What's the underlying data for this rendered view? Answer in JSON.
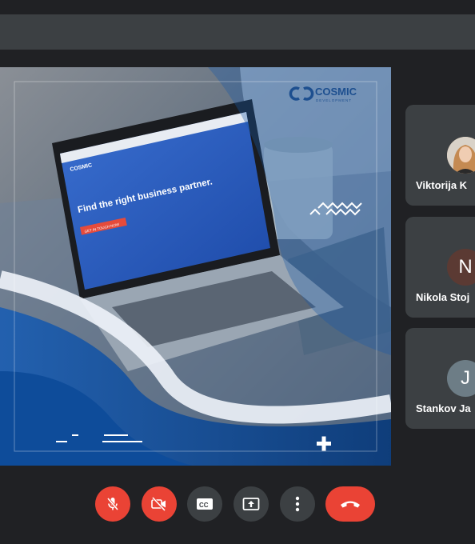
{
  "slide": {
    "brand_name": "COSMIC",
    "brand_sub": "DEVELOPMENT",
    "laptop_logo": "COSMIC",
    "laptop_headline": "Find the right business partner.",
    "laptop_cta": "GET IN TOUCH NOW"
  },
  "participants": [
    {
      "name": "Viktorija K",
      "avatar_type": "photo"
    },
    {
      "name": "Nikola Stoj",
      "initial": "N",
      "color": "#5b3a33"
    },
    {
      "name": "Stankov Ja",
      "initial": "J",
      "color": "#6d7d86"
    }
  ],
  "controls": [
    {
      "name": "mic-off-button",
      "icon": "mic-off-icon"
    },
    {
      "name": "camera-off-button",
      "icon": "camera-off-icon"
    },
    {
      "name": "captions-button",
      "icon": "closed-captions-icon"
    },
    {
      "name": "present-button",
      "icon": "present-screen-icon"
    },
    {
      "name": "more-options-button",
      "icon": "more-vert-icon"
    },
    {
      "name": "leave-call-button",
      "icon": "call-end-icon"
    }
  ]
}
